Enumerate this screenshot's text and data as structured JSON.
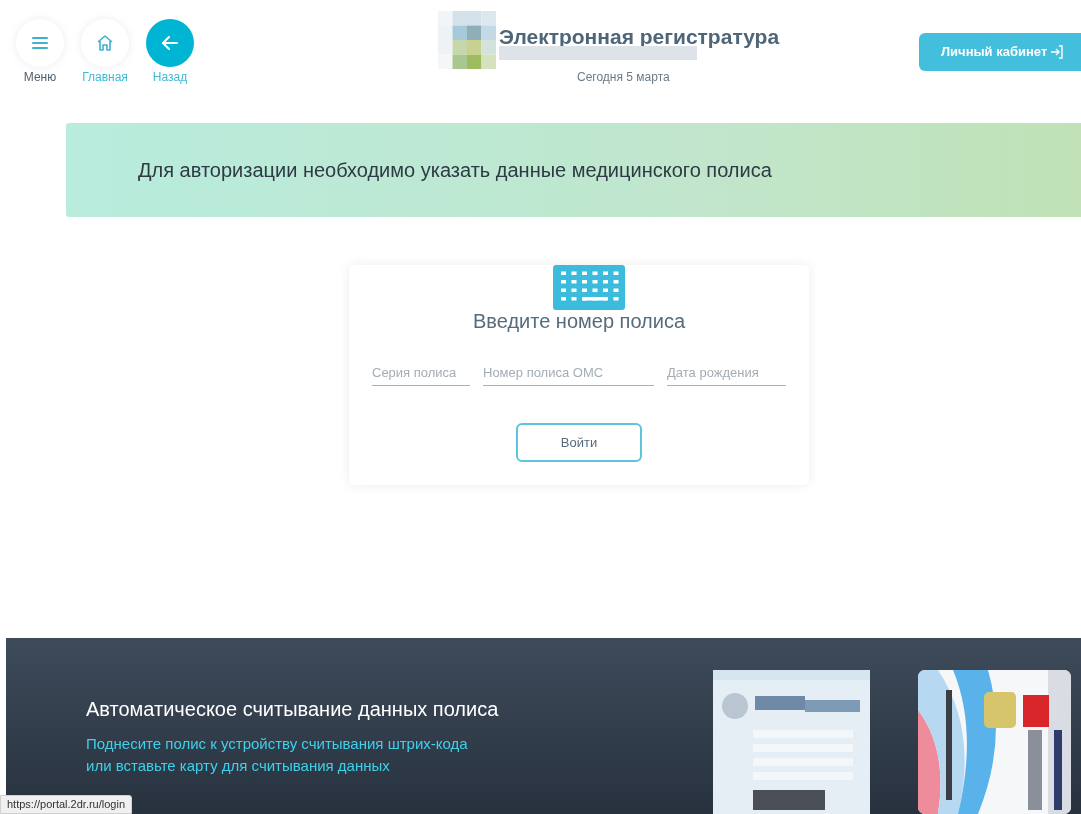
{
  "header": {
    "nav": [
      {
        "kind": "menu",
        "label": "Меню"
      },
      {
        "kind": "home",
        "label": "Главная"
      },
      {
        "kind": "back",
        "label": "Назад"
      }
    ],
    "title": "Электронная регистратура",
    "date": "Сегодня 5 марта",
    "account_button": "Личный кабинет"
  },
  "banner": {
    "text": "Для авторизации необходимо указать данные медицинского полиса"
  },
  "form": {
    "title": "Введите номер полиса",
    "fields": [
      {
        "placeholder": "Серия полиса"
      },
      {
        "placeholder": "Номер полиса ОМС"
      },
      {
        "placeholder": "Дата рождения"
      }
    ],
    "submit": "Войти"
  },
  "footer": {
    "title": "Автоматическое считывание данных полиса",
    "lines": [
      "Поднесите полис к устройству считывания штрих-кода",
      "или вставьте карту для считывания данных"
    ],
    "pictures": [
      {
        "kind": "picture"
      },
      {
        "kind": "picture"
      }
    ]
  },
  "status_bar": {
    "url": "https://portal.2dr.ru/login"
  }
}
